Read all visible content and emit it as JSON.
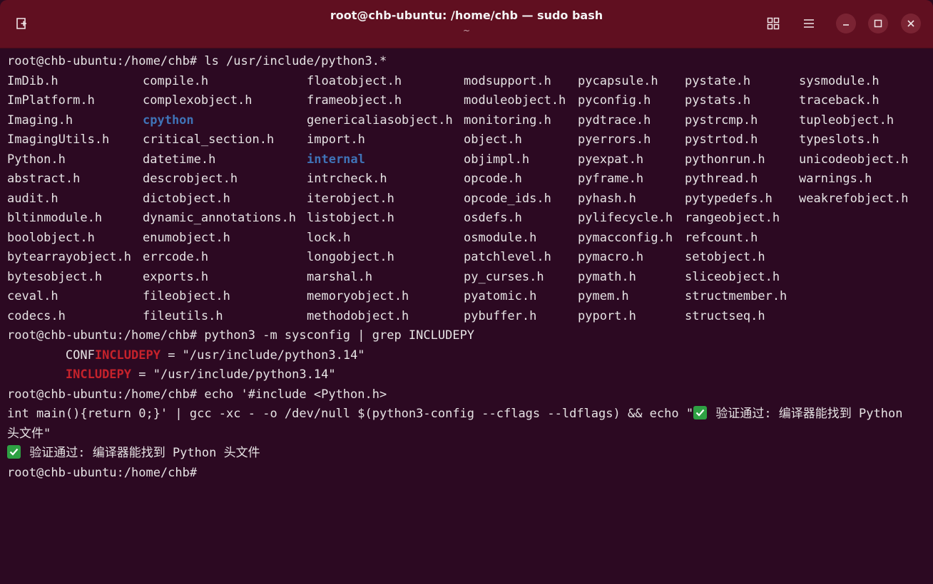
{
  "window": {
    "title": "root@chb-ubuntu: /home/chb — sudo bash",
    "subtitle": "~"
  },
  "terminal": {
    "prompt": "root@chb-ubuntu:/home/chb#",
    "cmd1": " ls /usr/include/python3.*",
    "ls_columns": [
      [
        "ImDib.h",
        "ImPlatform.h",
        "Imaging.h",
        "ImagingUtils.h",
        "Python.h",
        "abstract.h",
        "audit.h",
        "bltinmodule.h",
        "boolobject.h",
        "bytearrayobject.h",
        "bytesobject.h",
        "ceval.h",
        "codecs.h"
      ],
      [
        "compile.h",
        "complexobject.h",
        "cpython",
        "critical_section.h",
        "datetime.h",
        "descrobject.h",
        "dictobject.h",
        "dynamic_annotations.h",
        "enumobject.h",
        "errcode.h",
        "exports.h",
        "fileobject.h",
        "fileutils.h"
      ],
      [
        "floatobject.h",
        "frameobject.h",
        "genericaliasobject.h",
        "import.h",
        "internal",
        "intrcheck.h",
        "iterobject.h",
        "listobject.h",
        "lock.h",
        "longobject.h",
        "marshal.h",
        "memoryobject.h",
        "methodobject.h"
      ],
      [
        "modsupport.h",
        "moduleobject.h",
        "monitoring.h",
        "object.h",
        "objimpl.h",
        "opcode.h",
        "opcode_ids.h",
        "osdefs.h",
        "osmodule.h",
        "patchlevel.h",
        "py_curses.h",
        "pyatomic.h",
        "pybuffer.h"
      ],
      [
        "pycapsule.h",
        "pyconfig.h",
        "pydtrace.h",
        "pyerrors.h",
        "pyexpat.h",
        "pyframe.h",
        "pyhash.h",
        "pylifecycle.h",
        "pymacconfig.h",
        "pymacro.h",
        "pymath.h",
        "pymem.h",
        "pyport.h"
      ],
      [
        "pystate.h",
        "pystats.h",
        "pystrcmp.h",
        "pystrtod.h",
        "pythonrun.h",
        "pythread.h",
        "pytypedefs.h",
        "rangeobject.h",
        "refcount.h",
        "setobject.h",
        "sliceobject.h",
        "structmember.h",
        "structseq.h"
      ],
      [
        "sysmodule.h",
        "traceback.h",
        "tupleobject.h",
        "typeslots.h",
        "unicodeobject.h",
        "warnings.h",
        "weakrefobject.h",
        "",
        "",
        "",
        "",
        "",
        ""
      ]
    ],
    "directories": [
      "cpython",
      "internal"
    ],
    "cmd2": " python3 -m sysconfig | grep INCLUDEPY",
    "grep1": {
      "indent": "        ",
      "pre": "CONF",
      "match": "INCLUDEPY",
      "post": " = \"/usr/include/python3.14\""
    },
    "grep2": {
      "indent": "        ",
      "pre": "",
      "match": "INCLUDEPY",
      "post": " = \"/usr/include/python3.14\""
    },
    "cmd3_line1": " echo '#include <Python.h>",
    "cmd3_line2_pre": "int main(){return 0;}' | gcc -xc - -o /dev/null $(python3-config --cflags --ldflags) && echo \"",
    "cmd3_line2_post": " 验证通过: 编译器能找到 Python",
    "cmd3_line3": "头文件\"",
    "result": " 验证通过: 编译器能找到 Python 头文件",
    "colors": {
      "background": "#2c0922",
      "titlebar": "#600f20",
      "text": "#e6e3e4",
      "directory": "#3f73b7",
      "grep_match": "#c6222b",
      "check_mark": "#2ea043"
    }
  }
}
